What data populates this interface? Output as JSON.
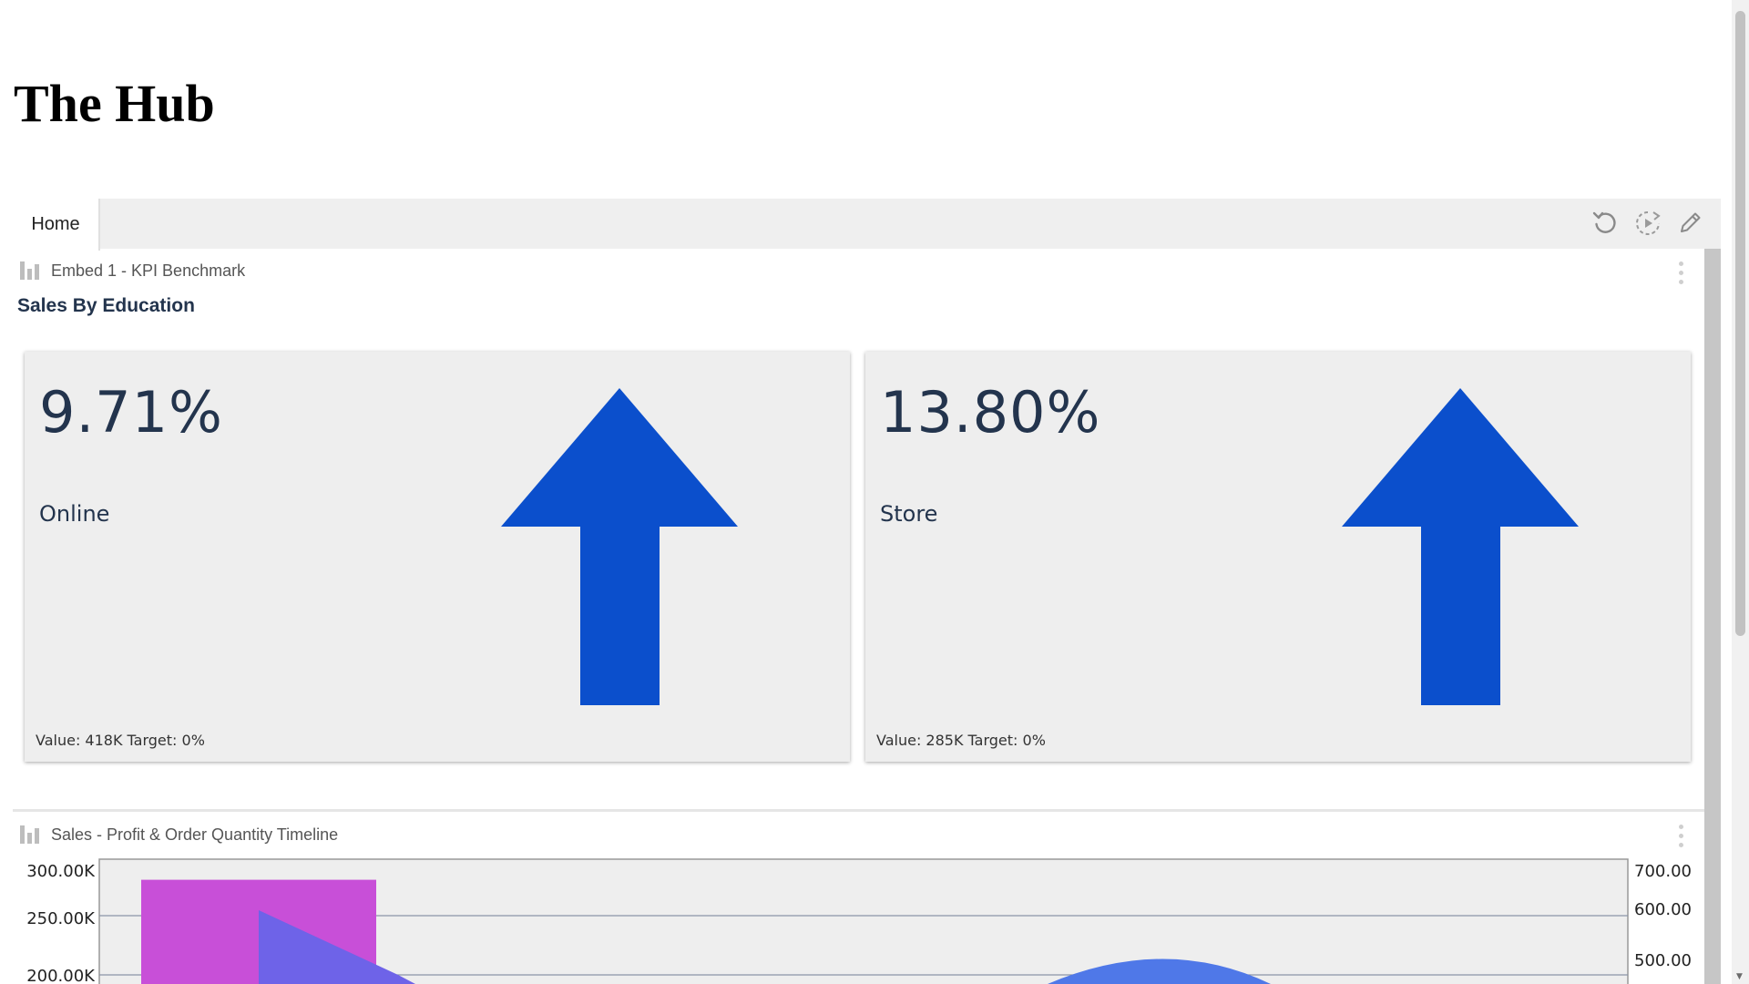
{
  "app": {
    "title": "The Hub"
  },
  "tabs": [
    {
      "label": "Home"
    }
  ],
  "toolbar": {
    "icons": [
      "refresh-icon",
      "play-icon",
      "edit-icon"
    ]
  },
  "panels": {
    "kpi": {
      "header": "Embed 1 - KPI Benchmark",
      "title": "Sales By Education",
      "cards": [
        {
          "value": "9.71%",
          "label": "Online",
          "footer": "Value: 418K Target: 0%",
          "trend": "up",
          "arrow_color": "#0b4fcc"
        },
        {
          "value": "13.80%",
          "label": "Store",
          "footer": "Value: 285K Target: 0%",
          "trend": "up",
          "arrow_color": "#0b4fcc"
        }
      ]
    },
    "timeline": {
      "header": "Sales - Profit & Order Quantity Timeline"
    }
  },
  "chart_data": {
    "type": "bar",
    "title": "",
    "y_left_ticks": [
      "300.00K",
      "250.00K",
      "200.00K"
    ],
    "y_right_ticks": [
      "700.00",
      "600.00",
      "500.00"
    ],
    "ylim_left": [
      200000,
      300000
    ],
    "ylim_right": [
      500,
      700
    ],
    "series": [
      {
        "type": "bar",
        "values": [
          290000
        ],
        "color": "#c84fd8"
      },
      {
        "type": "area",
        "values": [
          260000,
          200000
        ],
        "color": "#6e63e8"
      },
      {
        "type": "line",
        "values": [
          200000,
          210000,
          200000
        ],
        "color": "#4f78e8"
      }
    ],
    "grid": true
  }
}
